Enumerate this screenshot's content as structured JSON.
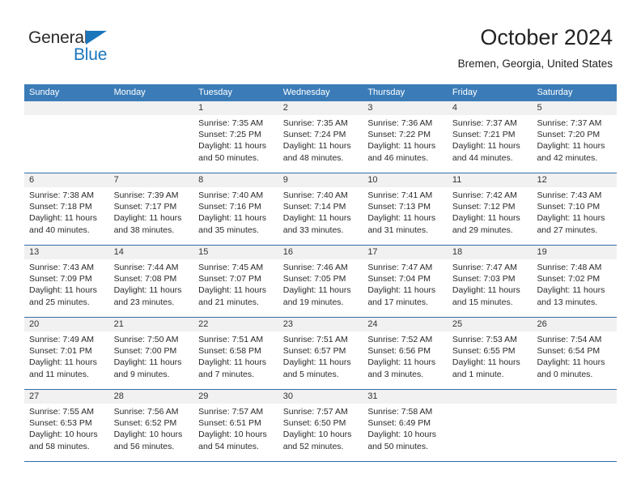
{
  "brand": {
    "name_part1": "General",
    "name_part2": "Blue",
    "accent_color": "#1b75bb"
  },
  "header": {
    "title": "October 2024",
    "location": "Bremen, Georgia, United States"
  },
  "calendar": {
    "header_color": "#3b7cb8",
    "weekdays": [
      "Sunday",
      "Monday",
      "Tuesday",
      "Wednesday",
      "Thursday",
      "Friday",
      "Saturday"
    ],
    "weeks": [
      [
        {
          "empty": true
        },
        {
          "empty": true
        },
        {
          "day": "1",
          "sunrise": "Sunrise: 7:35 AM",
          "sunset": "Sunset: 7:25 PM",
          "daylight": "Daylight: 11 hours and 50 minutes."
        },
        {
          "day": "2",
          "sunrise": "Sunrise: 7:35 AM",
          "sunset": "Sunset: 7:24 PM",
          "daylight": "Daylight: 11 hours and 48 minutes."
        },
        {
          "day": "3",
          "sunrise": "Sunrise: 7:36 AM",
          "sunset": "Sunset: 7:22 PM",
          "daylight": "Daylight: 11 hours and 46 minutes."
        },
        {
          "day": "4",
          "sunrise": "Sunrise: 7:37 AM",
          "sunset": "Sunset: 7:21 PM",
          "daylight": "Daylight: 11 hours and 44 minutes."
        },
        {
          "day": "5",
          "sunrise": "Sunrise: 7:37 AM",
          "sunset": "Sunset: 7:20 PM",
          "daylight": "Daylight: 11 hours and 42 minutes."
        }
      ],
      [
        {
          "day": "6",
          "sunrise": "Sunrise: 7:38 AM",
          "sunset": "Sunset: 7:18 PM",
          "daylight": "Daylight: 11 hours and 40 minutes."
        },
        {
          "day": "7",
          "sunrise": "Sunrise: 7:39 AM",
          "sunset": "Sunset: 7:17 PM",
          "daylight": "Daylight: 11 hours and 38 minutes."
        },
        {
          "day": "8",
          "sunrise": "Sunrise: 7:40 AM",
          "sunset": "Sunset: 7:16 PM",
          "daylight": "Daylight: 11 hours and 35 minutes."
        },
        {
          "day": "9",
          "sunrise": "Sunrise: 7:40 AM",
          "sunset": "Sunset: 7:14 PM",
          "daylight": "Daylight: 11 hours and 33 minutes."
        },
        {
          "day": "10",
          "sunrise": "Sunrise: 7:41 AM",
          "sunset": "Sunset: 7:13 PM",
          "daylight": "Daylight: 11 hours and 31 minutes."
        },
        {
          "day": "11",
          "sunrise": "Sunrise: 7:42 AM",
          "sunset": "Sunset: 7:12 PM",
          "daylight": "Daylight: 11 hours and 29 minutes."
        },
        {
          "day": "12",
          "sunrise": "Sunrise: 7:43 AM",
          "sunset": "Sunset: 7:10 PM",
          "daylight": "Daylight: 11 hours and 27 minutes."
        }
      ],
      [
        {
          "day": "13",
          "sunrise": "Sunrise: 7:43 AM",
          "sunset": "Sunset: 7:09 PM",
          "daylight": "Daylight: 11 hours and 25 minutes."
        },
        {
          "day": "14",
          "sunrise": "Sunrise: 7:44 AM",
          "sunset": "Sunset: 7:08 PM",
          "daylight": "Daylight: 11 hours and 23 minutes."
        },
        {
          "day": "15",
          "sunrise": "Sunrise: 7:45 AM",
          "sunset": "Sunset: 7:07 PM",
          "daylight": "Daylight: 11 hours and 21 minutes."
        },
        {
          "day": "16",
          "sunrise": "Sunrise: 7:46 AM",
          "sunset": "Sunset: 7:05 PM",
          "daylight": "Daylight: 11 hours and 19 minutes."
        },
        {
          "day": "17",
          "sunrise": "Sunrise: 7:47 AM",
          "sunset": "Sunset: 7:04 PM",
          "daylight": "Daylight: 11 hours and 17 minutes."
        },
        {
          "day": "18",
          "sunrise": "Sunrise: 7:47 AM",
          "sunset": "Sunset: 7:03 PM",
          "daylight": "Daylight: 11 hours and 15 minutes."
        },
        {
          "day": "19",
          "sunrise": "Sunrise: 7:48 AM",
          "sunset": "Sunset: 7:02 PM",
          "daylight": "Daylight: 11 hours and 13 minutes."
        }
      ],
      [
        {
          "day": "20",
          "sunrise": "Sunrise: 7:49 AM",
          "sunset": "Sunset: 7:01 PM",
          "daylight": "Daylight: 11 hours and 11 minutes."
        },
        {
          "day": "21",
          "sunrise": "Sunrise: 7:50 AM",
          "sunset": "Sunset: 7:00 PM",
          "daylight": "Daylight: 11 hours and 9 minutes."
        },
        {
          "day": "22",
          "sunrise": "Sunrise: 7:51 AM",
          "sunset": "Sunset: 6:58 PM",
          "daylight": "Daylight: 11 hours and 7 minutes."
        },
        {
          "day": "23",
          "sunrise": "Sunrise: 7:51 AM",
          "sunset": "Sunset: 6:57 PM",
          "daylight": "Daylight: 11 hours and 5 minutes."
        },
        {
          "day": "24",
          "sunrise": "Sunrise: 7:52 AM",
          "sunset": "Sunset: 6:56 PM",
          "daylight": "Daylight: 11 hours and 3 minutes."
        },
        {
          "day": "25",
          "sunrise": "Sunrise: 7:53 AM",
          "sunset": "Sunset: 6:55 PM",
          "daylight": "Daylight: 11 hours and 1 minute."
        },
        {
          "day": "26",
          "sunrise": "Sunrise: 7:54 AM",
          "sunset": "Sunset: 6:54 PM",
          "daylight": "Daylight: 11 hours and 0 minutes."
        }
      ],
      [
        {
          "day": "27",
          "sunrise": "Sunrise: 7:55 AM",
          "sunset": "Sunset: 6:53 PM",
          "daylight": "Daylight: 10 hours and 58 minutes."
        },
        {
          "day": "28",
          "sunrise": "Sunrise: 7:56 AM",
          "sunset": "Sunset: 6:52 PM",
          "daylight": "Daylight: 10 hours and 56 minutes."
        },
        {
          "day": "29",
          "sunrise": "Sunrise: 7:57 AM",
          "sunset": "Sunset: 6:51 PM",
          "daylight": "Daylight: 10 hours and 54 minutes."
        },
        {
          "day": "30",
          "sunrise": "Sunrise: 7:57 AM",
          "sunset": "Sunset: 6:50 PM",
          "daylight": "Daylight: 10 hours and 52 minutes."
        },
        {
          "day": "31",
          "sunrise": "Sunrise: 7:58 AM",
          "sunset": "Sunset: 6:49 PM",
          "daylight": "Daylight: 10 hours and 50 minutes."
        },
        {
          "empty": true
        },
        {
          "empty": true
        }
      ]
    ]
  }
}
